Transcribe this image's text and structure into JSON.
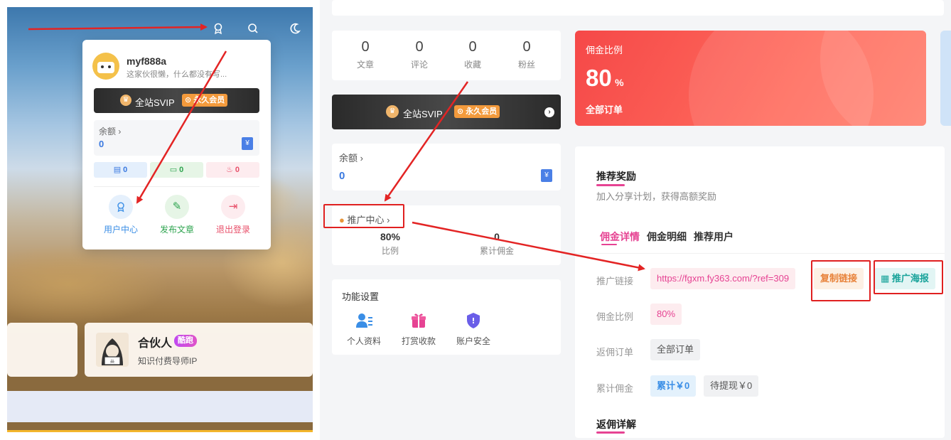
{
  "left": {
    "popup": {
      "username": "myf888a",
      "signature": "这家伙很懒，什么都没有写...",
      "vip_label": "全站SVIP",
      "vip_badge": "永久会员",
      "balance_label": "余额",
      "balance_value": "0",
      "stat_posts": "0",
      "stat_comments": "0",
      "stat_hot": "0",
      "actions": [
        {
          "label": "用户中心",
          "icon": "award-icon",
          "color": "#3a8ee6"
        },
        {
          "label": "发布文章",
          "icon": "edit-icon",
          "color": "#2ea44f"
        },
        {
          "label": "退出登录",
          "icon": "logout-icon",
          "color": "#e8506a"
        }
      ]
    },
    "partner": {
      "title": "合伙人",
      "tag": "酷跑",
      "subtitle": "知识付费导师IP"
    }
  },
  "middle": {
    "stats": [
      {
        "value": "0",
        "label": "文章"
      },
      {
        "value": "0",
        "label": "评论"
      },
      {
        "value": "0",
        "label": "收藏"
      },
      {
        "value": "0",
        "label": "粉丝"
      }
    ],
    "vip_label": "全站SVIP",
    "vip_badge": "永久会员",
    "balance_label": "余额",
    "balance_value": "0",
    "promo": {
      "title": "推广中心",
      "rate_value": "80%",
      "rate_label": "比例",
      "total_value": "0",
      "total_label": "累计佣金"
    },
    "functions": {
      "title": "功能设置",
      "items": [
        {
          "label": "个人资料",
          "icon": "user-profile-icon"
        },
        {
          "label": "打赏收款",
          "icon": "gift-icon"
        },
        {
          "label": "账户安全",
          "icon": "shield-icon"
        }
      ]
    }
  },
  "right": {
    "commission": {
      "label": "佣金比例",
      "value": "80",
      "unit": "%",
      "sub": "全部订单"
    },
    "reward": {
      "title": "推荐奖励",
      "subtitle": "加入分享计划，获得高额奖励",
      "tabs": [
        "佣金详情",
        "佣金明细",
        "推荐用户"
      ],
      "link_label": "推广链接",
      "link_value": "https://fgxm.fy363.com/?ref=309",
      "copy_button": "复制链接",
      "poster_button": "推广海报",
      "rate_label": "佣金比例",
      "rate_value": "80%",
      "order_label": "返佣订单",
      "order_value": "全部订单",
      "total_label": "累计佣金",
      "total_value": "累计￥0",
      "pending_value": "待提现￥0",
      "detail_title": "返佣详解"
    }
  },
  "colors": {
    "accent_pink": "#e64393",
    "arrow_red": "#e32424",
    "link_blue": "#3a79e0"
  }
}
